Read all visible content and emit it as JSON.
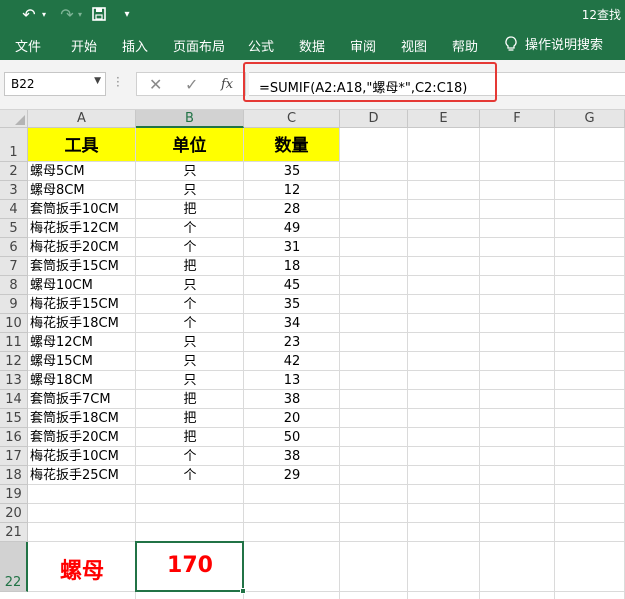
{
  "titlebar": {
    "title": "12查找",
    "icons": [
      "undo-icon",
      "redo-icon",
      "save-icon",
      "customize-qat-icon"
    ]
  },
  "ribbon": {
    "tabs": [
      "文件",
      "开始",
      "插入",
      "页面布局",
      "公式",
      "数据",
      "审阅",
      "视图",
      "帮助"
    ],
    "tell_me": "操作说明搜索"
  },
  "formula_bar": {
    "name_box": "B22",
    "cancel_icon": "✕",
    "enter_icon": "✓",
    "fx_label": "fx",
    "formula": "=SUMIF(A2:A18,\"螺母*\",C2:C18)"
  },
  "columns": [
    "A",
    "B",
    "C",
    "D",
    "E",
    "F",
    "G"
  ],
  "selected_column": "B",
  "selected_row": "22",
  "rows": [
    "1",
    "2",
    "3",
    "4",
    "5",
    "6",
    "7",
    "8",
    "9",
    "10",
    "11",
    "12",
    "13",
    "14",
    "15",
    "16",
    "17",
    "18",
    "19",
    "20",
    "21",
    "22"
  ],
  "header": {
    "a": "工具",
    "b": "单位",
    "c": "数量"
  },
  "data": [
    {
      "tool": "螺母5CM",
      "unit": "只",
      "qty": "35"
    },
    {
      "tool": "螺母8CM",
      "unit": "只",
      "qty": "12"
    },
    {
      "tool": "套筒扳手10CM",
      "unit": "把",
      "qty": "28"
    },
    {
      "tool": "梅花扳手12CM",
      "unit": "个",
      "qty": "49"
    },
    {
      "tool": "梅花扳手20CM",
      "unit": "个",
      "qty": "31"
    },
    {
      "tool": "套筒扳手15CM",
      "unit": "把",
      "qty": "18"
    },
    {
      "tool": "螺母10CM",
      "unit": "只",
      "qty": "45"
    },
    {
      "tool": "梅花扳手15CM",
      "unit": "个",
      "qty": "35"
    },
    {
      "tool": "梅花扳手18CM",
      "unit": "个",
      "qty": "34"
    },
    {
      "tool": "螺母12CM",
      "unit": "只",
      "qty": "23"
    },
    {
      "tool": "螺母15CM",
      "unit": "只",
      "qty": "42"
    },
    {
      "tool": "螺母18CM",
      "unit": "只",
      "qty": "13"
    },
    {
      "tool": "套筒扳手7CM",
      "unit": "把",
      "qty": "38"
    },
    {
      "tool": "套筒扳手18CM",
      "unit": "把",
      "qty": "20"
    },
    {
      "tool": "套筒扳手20CM",
      "unit": "把",
      "qty": "50"
    },
    {
      "tool": "梅花扳手10CM",
      "unit": "个",
      "qty": "38"
    },
    {
      "tool": "梅花扳手25CM",
      "unit": "个",
      "qty": "29"
    }
  ],
  "result": {
    "label": "螺母",
    "value": "170"
  },
  "colors": {
    "excel_green": "#217346",
    "header_fill": "#ffff00",
    "result_text": "#ff0000",
    "highlight_box": "#e53935"
  }
}
